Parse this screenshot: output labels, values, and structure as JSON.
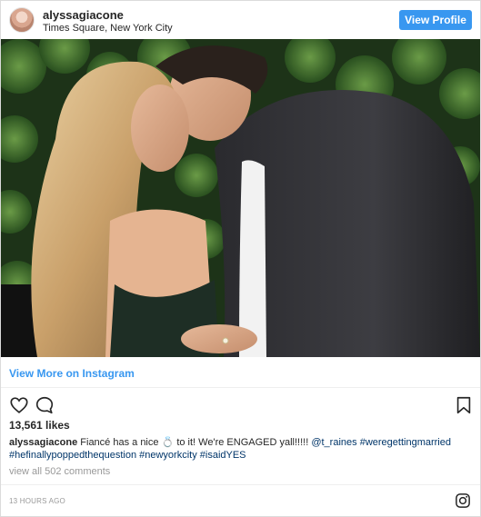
{
  "header": {
    "username": "alyssagiacone",
    "location": "Times Square, New York City",
    "view_profile_label": "View Profile"
  },
  "photo": {
    "description_icon": "photo-couple-kissing"
  },
  "view_more_label": "View More on Instagram",
  "actions": {
    "like_icon": "heart-icon",
    "comment_icon": "comment-icon",
    "save_icon": "bookmark-icon"
  },
  "likes": "13,561 likes",
  "caption": {
    "username": "alyssagiacone",
    "text_before": "Fiancé has a nice",
    "emoji": "💍",
    "text_after": "to it! We're ENGAGED yall!!!!!",
    "mention": "@t_raines",
    "tags": [
      "#weregettingmarried",
      "#hefinallypoppedthequestion",
      "#newyorkcity",
      "#isaidYES"
    ]
  },
  "comments_label": "view all 502 comments",
  "timestamp": "13 HOURS AGO",
  "colors": {
    "accent": "#3897f0",
    "hashtag": "#003569",
    "muted": "#999999",
    "border": "#dbdbdb"
  }
}
